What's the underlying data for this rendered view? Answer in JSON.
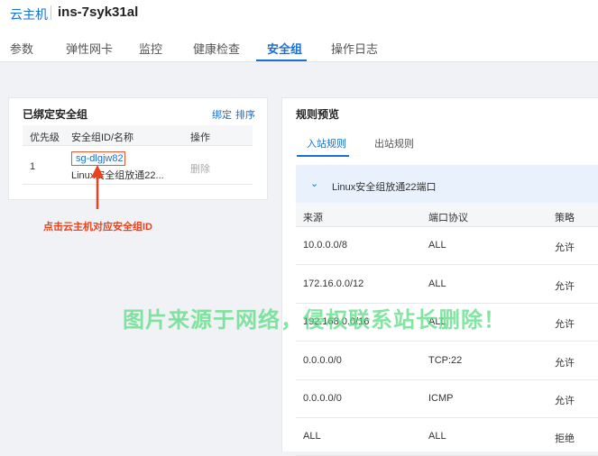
{
  "header": {
    "root": "云主机",
    "instance_id": "ins-7syk31al"
  },
  "tabs": [
    {
      "label": "参数"
    },
    {
      "label": "弹性网卡"
    },
    {
      "label": "监控"
    },
    {
      "label": "健康检查"
    },
    {
      "label": "安全组",
      "active": true
    },
    {
      "label": "操作日志"
    }
  ],
  "bound_groups": {
    "title": "已绑定安全组",
    "actions": {
      "bind": "绑定",
      "sort": "排序"
    },
    "columns": {
      "priority": "优先级",
      "id_name": "安全组ID/名称",
      "ops": "操作"
    },
    "rows": [
      {
        "priority": "1",
        "id": "sg-dlgjw82",
        "name": "Linux安全组放通22...",
        "action": "删除"
      }
    ]
  },
  "annotation": "点击云主机对应安全组ID",
  "rules_preview": {
    "title": "规则预览",
    "tabs": {
      "inbound": "入站规则",
      "outbound": "出站规则"
    },
    "group_name": "Linux安全组放通22端口",
    "columns": {
      "source": "来源",
      "protocol": "端口协议",
      "policy": "策略"
    },
    "rows": [
      {
        "source": "10.0.0.0/8",
        "protocol": "ALL",
        "policy": "允许"
      },
      {
        "source": "172.16.0.0/12",
        "protocol": "ALL",
        "policy": "允许"
      },
      {
        "source": "192.168.0.0/16",
        "protocol": "ALL",
        "policy": "允许"
      },
      {
        "source": "0.0.0.0/0",
        "protocol": "TCP:22",
        "policy": "允许"
      },
      {
        "source": "0.0.0.0/0",
        "protocol": "ICMP",
        "policy": "允许"
      },
      {
        "source": "ALL",
        "protocol": "ALL",
        "policy": "拒绝"
      }
    ]
  },
  "watermark": "图片来源于网络，侵权联系站长删除！",
  "colors": {
    "accent": "#1a6fd0",
    "annotation": "#e8421f",
    "watermark": "#5adc82"
  },
  "icons": {
    "expand": "chevron-down-icon",
    "pointer": "arrow-up-icon"
  }
}
